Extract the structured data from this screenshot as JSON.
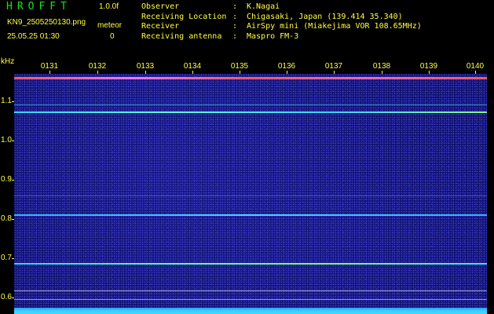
{
  "app": {
    "title": "HROFFT",
    "version": "1.0.0f",
    "filename": "KN9_2505250130.png",
    "meteor_label": "meteor",
    "meteor_count": "0",
    "datetime": "25.05.25 01:30"
  },
  "info": [
    {
      "key": "Observer",
      "value": "K.Nagai"
    },
    {
      "key": "Receiving Location",
      "value": "Chigasaki, Japan (139.414 35.340)"
    },
    {
      "key": "Receiver",
      "value": "AirSpy mini (Miakejima VOR 108.65MHz)"
    },
    {
      "key": "Receiving antenna",
      "value": "Maspro FM-3"
    }
  ],
  "axis": {
    "y_unit": "kHz",
    "x_ticks": [
      "0131",
      "0132",
      "0133",
      "0134",
      "0135",
      "0136",
      "0137",
      "0138",
      "0139",
      "0140"
    ],
    "y_ticks": [
      "1.1",
      "1.0",
      "0.9",
      "0.8",
      "0.7",
      "0.6"
    ]
  },
  "colors": {
    "background": "#000000",
    "spectrogram": "#10106a",
    "label": "#ffff40",
    "title": "#18e018"
  }
}
